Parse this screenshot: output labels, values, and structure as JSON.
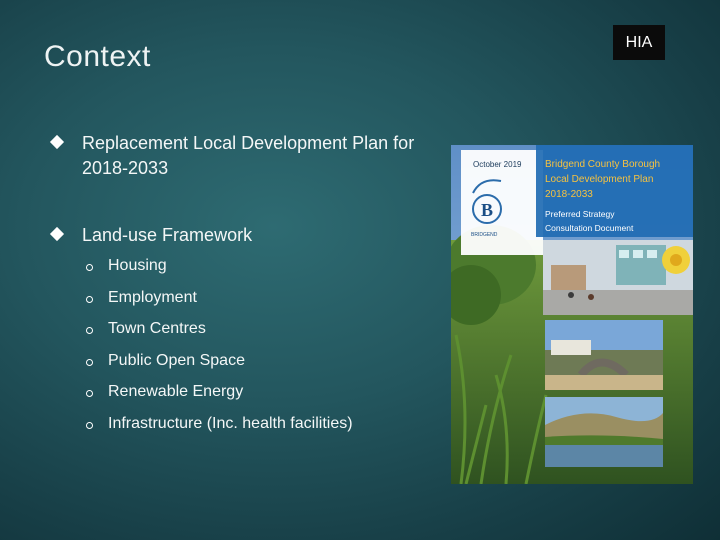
{
  "slide": {
    "title": "Context",
    "badge": "HIA"
  },
  "bullets": [
    {
      "text": "Replacement Local Development Plan for 2018-2033"
    },
    {
      "text": "Land-use Framework"
    }
  ],
  "sub_bullets": [
    "Housing",
    "Employment",
    "Town Centres",
    "Public Open Space",
    "Renewable Energy",
    "Infrastructure (Inc. health facilities)"
  ],
  "cover": {
    "date": "October 2019",
    "heading_line1": "Bridgend County Borough",
    "heading_line2": "Local Development Plan",
    "heading_line3": "2018-2033",
    "subheading_line1": "Preferred Strategy",
    "subheading_line2": "Consultation Document",
    "logo_text": "BRIDGEND"
  }
}
